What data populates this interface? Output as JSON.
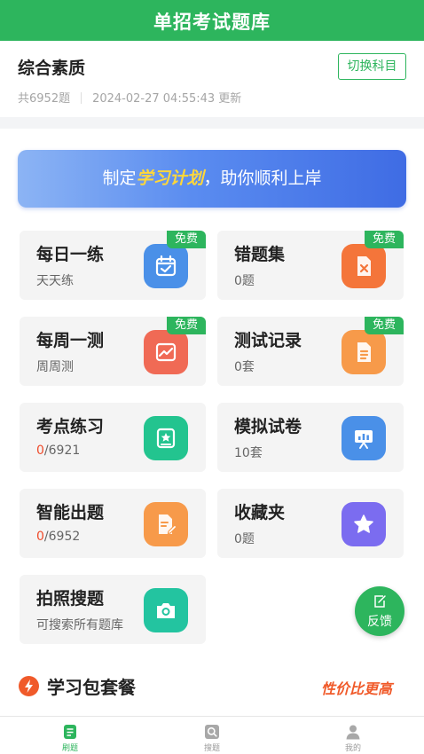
{
  "header": {
    "title": "单招考试题库"
  },
  "subject": {
    "name": "综合素质",
    "switch_label": "切换科目",
    "count": "共6952题",
    "updated": "2024-02-27 04:55:43 更新"
  },
  "banner": {
    "prefix": "制定",
    "highlight": "学习计划",
    "suffix": "，助你顺利上岸"
  },
  "cards": [
    {
      "title": "每日一练",
      "sub": "天天练",
      "badge": "免费",
      "icon": "calendar-icon",
      "color": "#4a90e8"
    },
    {
      "title": "错题集",
      "sub": "0题",
      "badge": "免费",
      "icon": "wrong-file-icon",
      "color": "#f4753a"
    },
    {
      "title": "每周一测",
      "sub": "周周测",
      "badge": "免费",
      "icon": "chart-image-icon",
      "color": "#f06a55"
    },
    {
      "title": "测试记录",
      "sub": "0套",
      "badge": "免费",
      "icon": "document-icon",
      "color": "#f79a4a"
    },
    {
      "title": "考点练习",
      "sub_red": "0",
      "sub_rest": "/6921",
      "icon": "star-book-icon",
      "color": "#23c48f"
    },
    {
      "title": "模拟试卷",
      "sub": "10套",
      "icon": "presentation-icon",
      "color": "#4a90e8"
    },
    {
      "title": "智能出题",
      "sub_red": "0",
      "sub_rest": "/6952",
      "icon": "edit-doc-icon",
      "color": "#f79a4a"
    },
    {
      "title": "收藏夹",
      "sub": "0题",
      "icon": "star-icon",
      "color": "#7b6cf0"
    },
    {
      "title": "拍照搜题",
      "sub": "可搜索所有题库",
      "icon": "camera-icon",
      "color": "#23c4a0"
    }
  ],
  "feedback": {
    "label": "反馈"
  },
  "package": {
    "title": "学习包套餐",
    "tag": "性价比更高"
  },
  "tabs": [
    {
      "label": "刷题",
      "icon": "practice-icon"
    },
    {
      "label": "搜题",
      "icon": "search-icon"
    },
    {
      "label": "我的",
      "icon": "profile-icon"
    }
  ],
  "colors": {
    "brand": "#2db55d",
    "accent_red": "#ef4b2b",
    "package_orange": "#f05a2a"
  }
}
